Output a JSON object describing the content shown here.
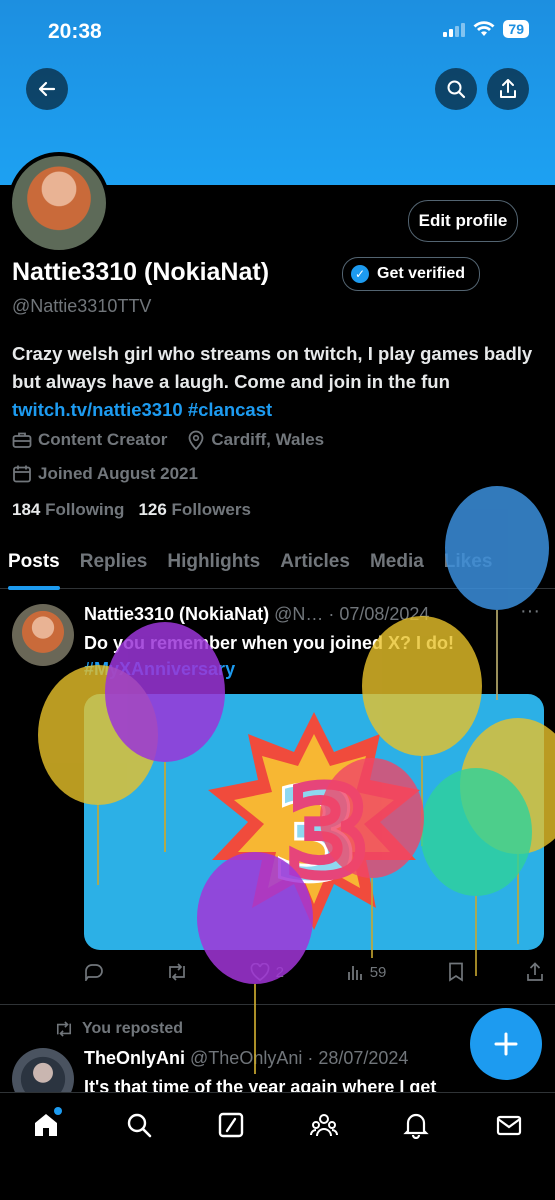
{
  "status": {
    "time": "20:38",
    "battery": "79"
  },
  "profile": {
    "edit_button": "Edit profile",
    "display_name": "Nattie3310 (NokiaNat)",
    "get_verified": "Get verified",
    "handle": "@Nattie3310TTV",
    "bio_text": "Crazy welsh girl who streams on twitch, I play games badly but always have a laugh. Come and join in the fun",
    "bio_link": "twitch.tv/nattie3310",
    "bio_hashtag": "#clancast",
    "category": "Content Creator",
    "location": "Cardiff, Wales",
    "joined": "Joined August 2021",
    "following_count": "184",
    "following_label": "Following",
    "followers_count": "126",
    "followers_label": "Followers"
  },
  "tabs": [
    "Posts",
    "Replies",
    "Highlights",
    "Articles",
    "Media",
    "Likes"
  ],
  "tweets": [
    {
      "name": "Nattie3310 (NokiaNat)",
      "handle_date": "@N… · 07/08/2024",
      "text": "Do you remember when you joined X? I do!",
      "hashtag": "#MyXAnniversary",
      "likes": "2",
      "views": "59"
    },
    {
      "repost_label": "You reposted",
      "name": "TheOnlyAni",
      "handle_date": "@TheOnlyAni · 28/07/2024",
      "text": "It's that time of the year again where I get"
    }
  ],
  "colors": {
    "accent": "#1d9bf0",
    "banner": "#1da1f2",
    "background": "#000000"
  },
  "icons": [
    "back-arrow-icon",
    "search-icon",
    "share-icon",
    "briefcase-icon",
    "location-pin-icon",
    "calendar-icon",
    "home-icon",
    "explore-icon",
    "grok-icon",
    "communities-icon",
    "bell-icon",
    "mail-icon",
    "compose-plus-icon"
  ]
}
